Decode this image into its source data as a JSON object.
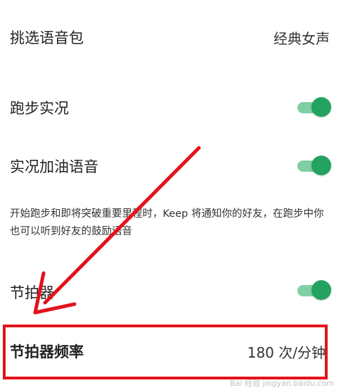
{
  "settings": {
    "voice_pack": {
      "label": "挑选语音包",
      "value": "经典女声"
    },
    "run_commentary": {
      "label": "跑步实况",
      "enabled": true
    },
    "cheer_voice": {
      "label": "实况加油语音",
      "enabled": true,
      "description": "开始跑步和即将突破重要里程时，Keep 将通知你的好友，在跑步中你也可以听到好友的鼓励语音"
    },
    "metronome": {
      "label": "节拍器",
      "enabled": true
    },
    "metronome_rate": {
      "label": "节拍器频率",
      "value": "180 次/分钟"
    }
  },
  "annotation": {
    "color": "#e3121b"
  },
  "toggle_colors": {
    "track": "#7fcfa3",
    "knob": "#23a35f"
  },
  "watermark": "Bai 经验 jingyan.baidu.com"
}
